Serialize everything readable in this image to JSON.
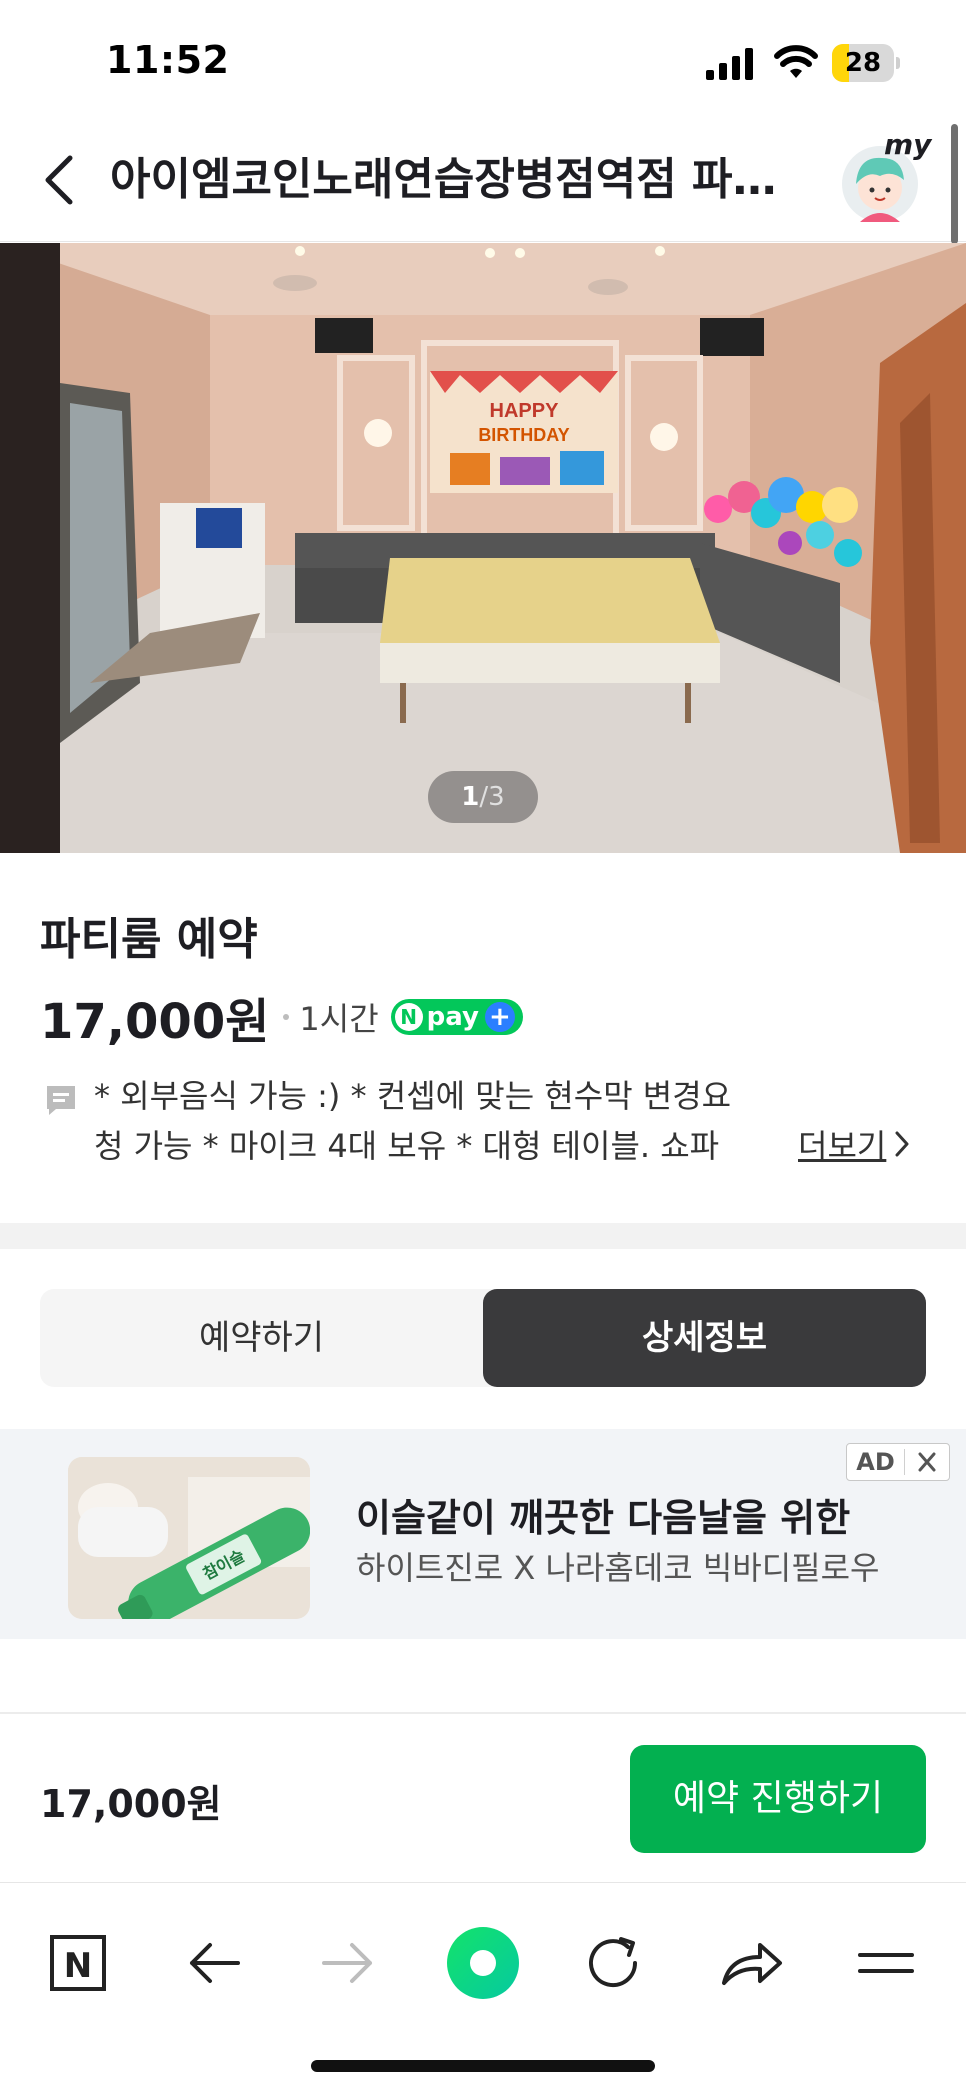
{
  "status_bar": {
    "time": "11:52",
    "battery_level": "28",
    "battery_fraction": 0.28,
    "icons": [
      "signal-icon",
      "wifi-icon",
      "battery-icon"
    ]
  },
  "header": {
    "title": "아이엠코인노래연습장병점역점 파티룸",
    "back_icon": "chevron-left-icon",
    "avatar_label": "my"
  },
  "gallery": {
    "current": "1",
    "separator": "/",
    "total": "3",
    "photo_text": [
      "HAPPY",
      "BIRTHDAY"
    ]
  },
  "product": {
    "title": "파티룸 예약",
    "price": "17,000원",
    "duration": "1시간",
    "npay_text": "pay",
    "npay_n": "N",
    "npay_plus": "+",
    "description_line1": "* 외부음식 가능 :) * 컨셉에 맞는 현수막 변경요",
    "description_line2": "청 가능 * 마이크 4대 보유 * 대형 테이블. 쇼파",
    "more_label": "더보기"
  },
  "tabs": [
    {
      "label": "예약하기",
      "active": false
    },
    {
      "label": "상세정보",
      "active": true
    }
  ],
  "ad": {
    "title": "이슬같이 깨끗한 다음날을 위한",
    "subtitle": "하이트진로 X 나라홈데코 빅바디필로우",
    "badge": "AD",
    "image_text": "참이슬"
  },
  "booking": {
    "total": "17,000원",
    "cta": "예약 진행하기",
    "cta_color": "#03b050"
  },
  "toolbar": {
    "items": [
      "naver-home-icon",
      "back-arrow-icon",
      "forward-arrow-icon",
      "green-dot-button-icon",
      "reload-icon",
      "share-icon",
      "menu-icon"
    ],
    "naver_letter": "N"
  }
}
